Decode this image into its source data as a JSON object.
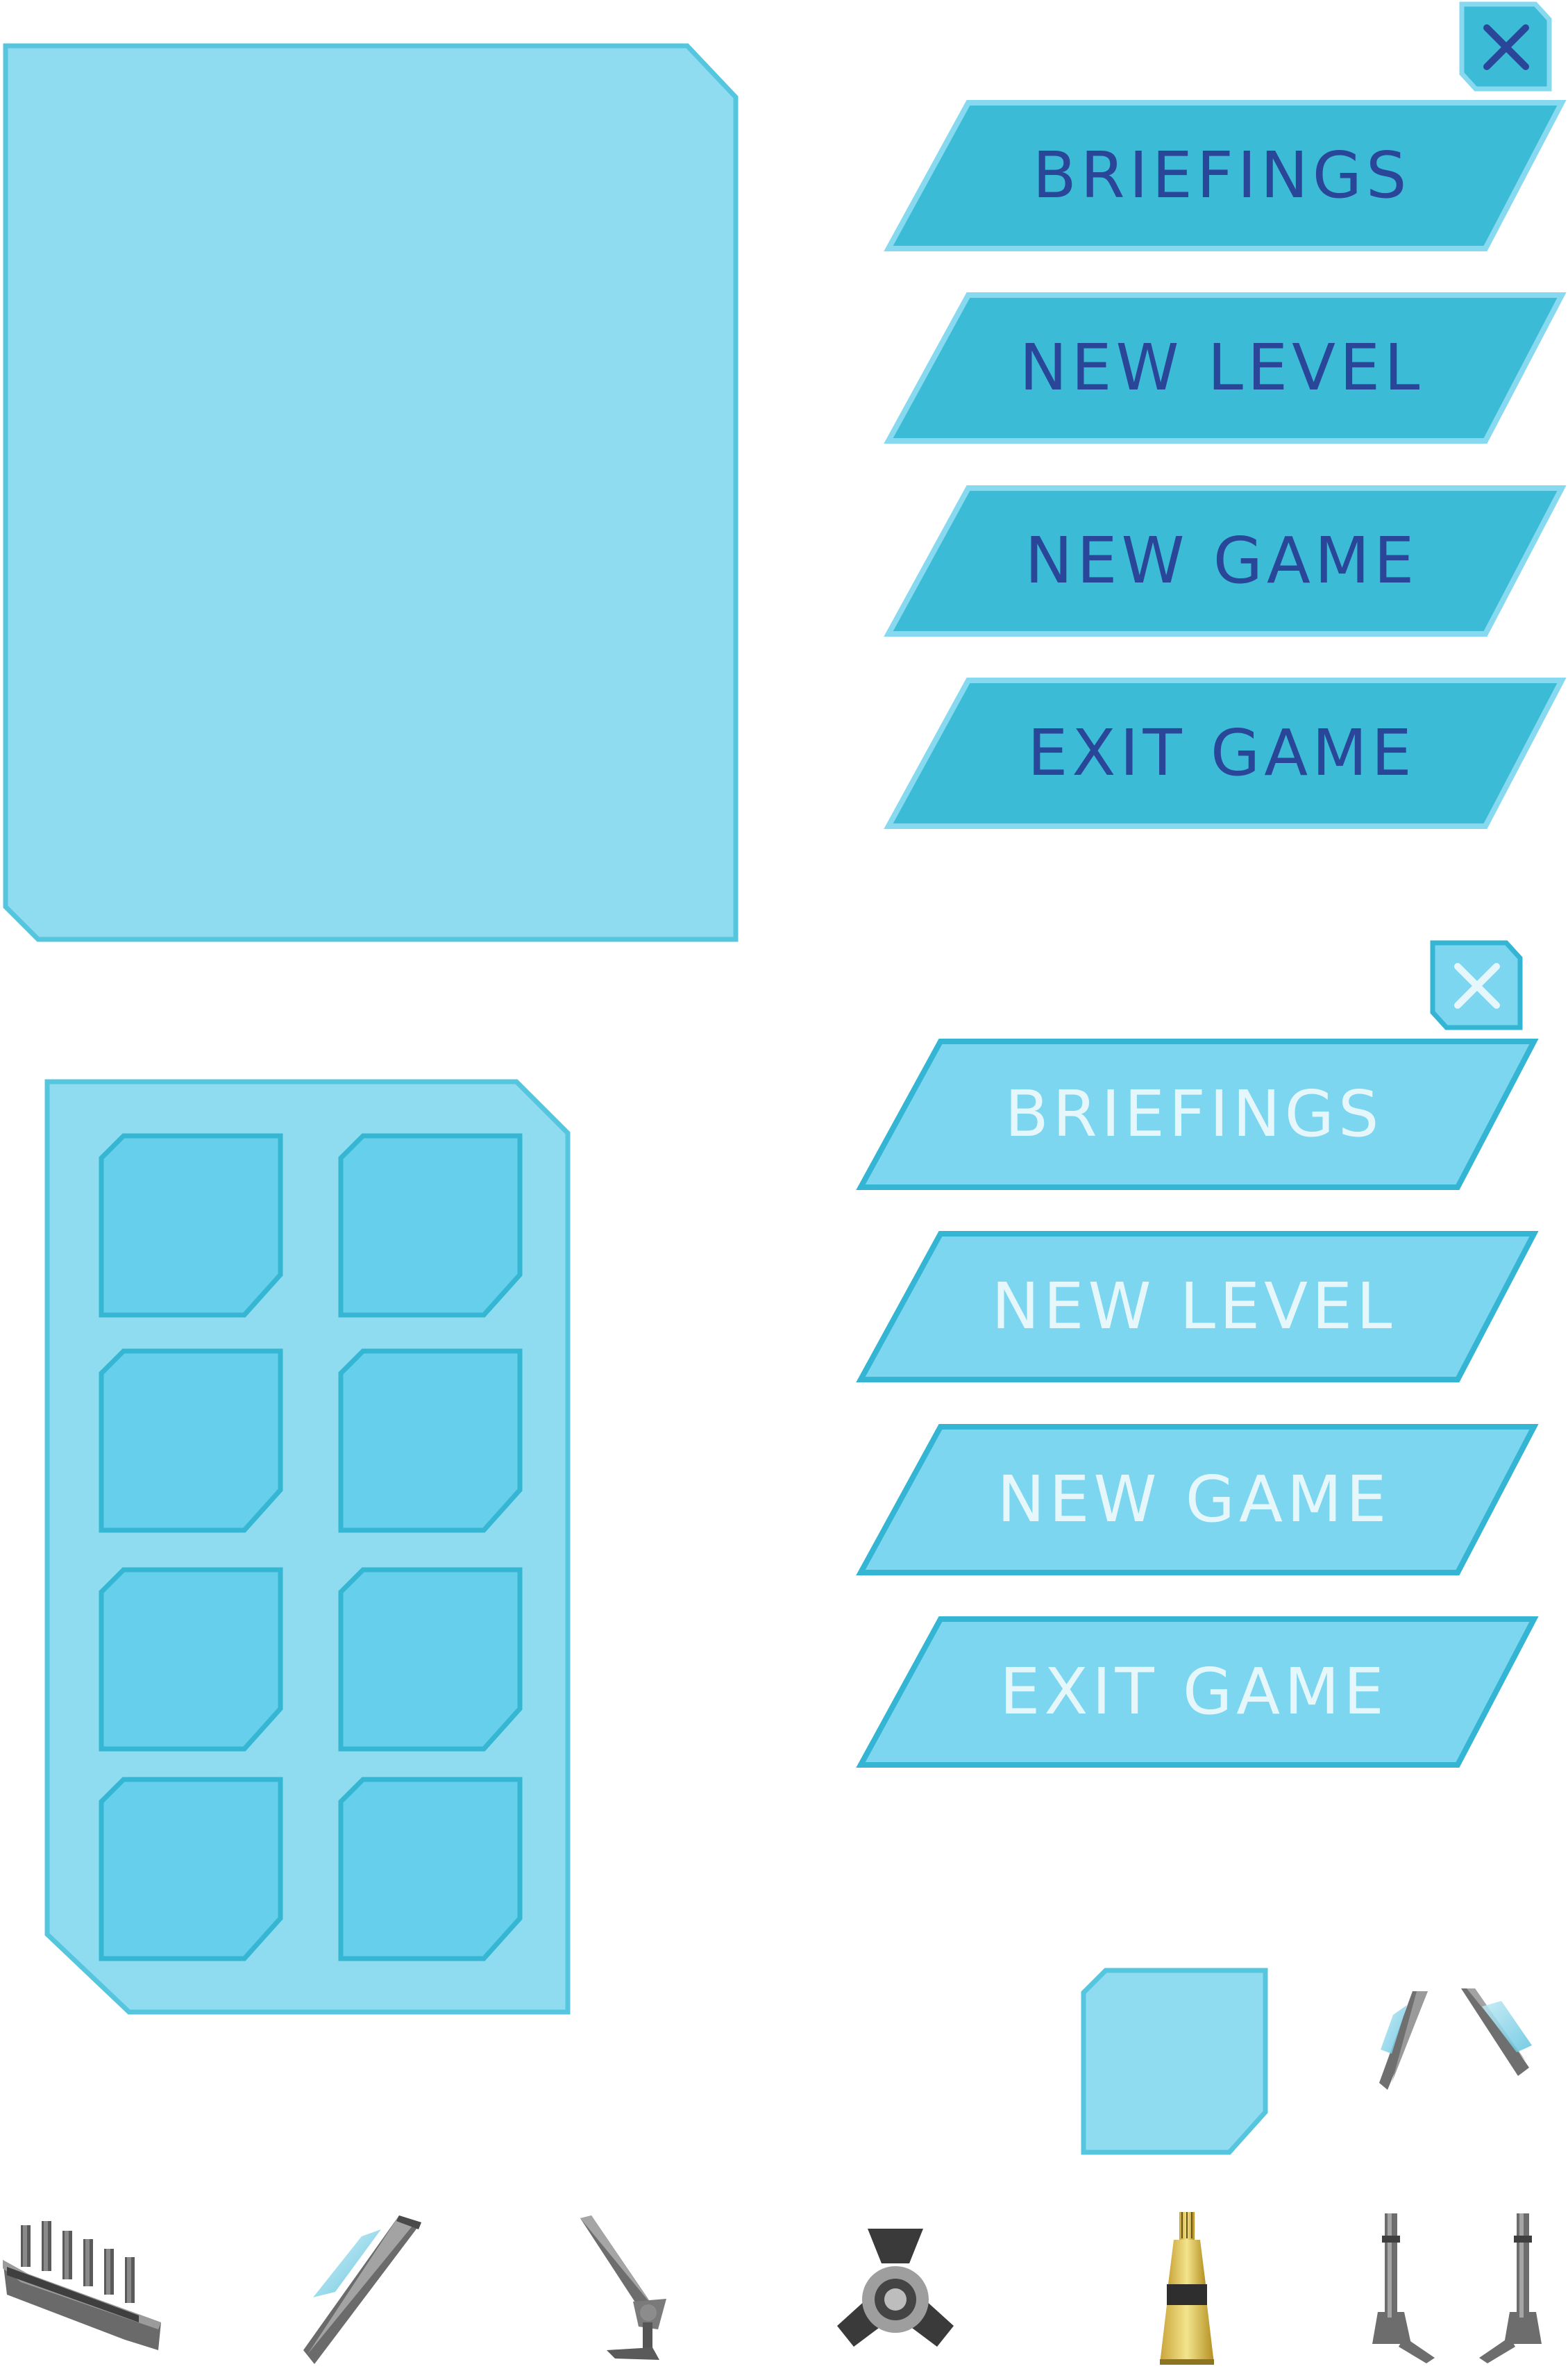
{
  "theme": {
    "panel_fill": "#8fdcf1",
    "panel_stroke": "#56c6df",
    "slot_fill": "#66cfeb",
    "slot_stroke": "#35b6d3",
    "button_dark_fill": "#3bbbd5",
    "button_dark_stroke": "#86d9ef",
    "button_dark_text": "#2a4699",
    "button_light_fill": "#7dd6ef",
    "button_light_stroke": "#34b5d3",
    "button_light_text": "#e6f7fb"
  },
  "menu_dark": {
    "close_icon": "close-icon",
    "buttons": [
      {
        "label": "BRIEFINGS"
      },
      {
        "label": "NEW LEVEL"
      },
      {
        "label": "NEW GAME"
      },
      {
        "label": "EXIT GAME"
      }
    ]
  },
  "menu_light": {
    "close_icon": "close-icon",
    "buttons": [
      {
        "label": "BRIEFINGS"
      },
      {
        "label": "NEW LEVEL"
      },
      {
        "label": "NEW GAME"
      },
      {
        "label": "EXIT GAME"
      }
    ]
  },
  "inventory": {
    "slot_count": 8
  },
  "assets": [
    {
      "icon": "battleship-icon"
    },
    {
      "icon": "blade-icon"
    },
    {
      "icon": "cannon-turret-icon"
    },
    {
      "icon": "propeller-icon"
    },
    {
      "icon": "missile-tower-icon"
    },
    {
      "icon": "twin-turret-icon"
    }
  ]
}
